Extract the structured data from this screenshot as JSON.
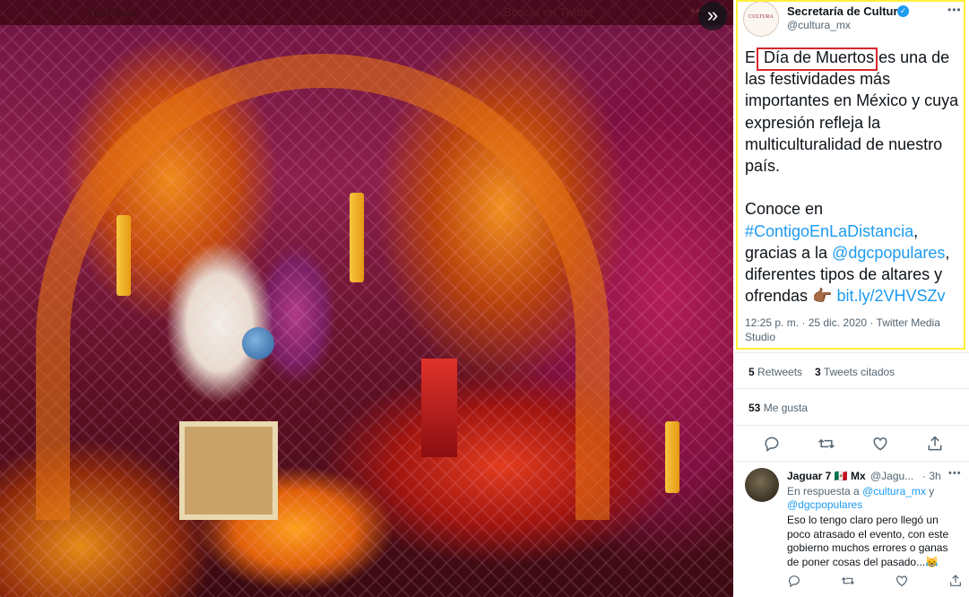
{
  "viewer": {
    "title": "Twittear",
    "search_placeholder": "Buscar en Twitter",
    "collapse_icon": "double-chevron-right-icon",
    "back_icon": "back-arrow-icon",
    "more_icon": "more-icon"
  },
  "tweet": {
    "author_name": "Secretaría de Cultura",
    "author_handle": "@cultura_mx",
    "avatar_text": "CULTURA",
    "verified_icon": "verified-badge-icon",
    "text_prefix": "El ",
    "text_highlight": "Día de Muertos",
    "text_body": " es una de las festividades más importantes en México y cuya expresión refleja la multiculturalidad de nuestro país.",
    "text_p2_a": "Conoce en ",
    "hashtag": "#ContigoEnLaDistancia",
    "text_p2_b": ", gracias a la ",
    "mention": "@dgcpopulares",
    "text_p2_c": ", diferentes tipos de altares y ofrendas ",
    "emoji": "👉🏾",
    "link": "bit.ly/2VHVSZv",
    "timestamp": "12:25 p. m. · 25 dic. 2020 · Twitter Media Studio",
    "retweets_count": "5",
    "retweets_label": "Retweets",
    "quotes_count": "3",
    "quotes_label": "Tweets citados",
    "likes_count": "53",
    "likes_label": "Me gusta",
    "actions": [
      "reply-icon",
      "retweet-icon",
      "like-icon",
      "share-icon"
    ]
  },
  "reply": {
    "name": "Jaguar 7 🇲🇽 Mx",
    "handle": "@Jagu...",
    "time": "· 3h",
    "context_prefix": "En respuesta a ",
    "context_mention_1": "@cultura_mx",
    "context_join": " y ",
    "context_mention_2": "@dgcpopulares",
    "text": "Eso lo tengo claro pero llegó un poco atrasado el evento, con este gobierno muchos errores o ganas de poner cosas del pasado...😹"
  },
  "colors": {
    "accent": "#1d9bf0",
    "highlight_border": "#ffef3a",
    "annotation_red": "#d7262c"
  }
}
